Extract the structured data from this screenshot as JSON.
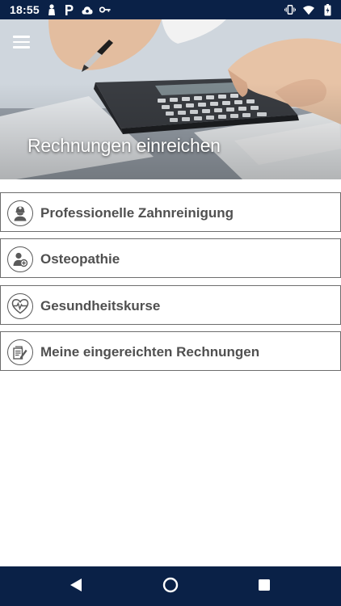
{
  "status_bar": {
    "time": "18:55",
    "left_icons": [
      "person-icon",
      "parking-icon",
      "cloud-icon",
      "key-icon"
    ],
    "right_icons": [
      "vibrate-icon",
      "wifi-icon",
      "battery-icon"
    ]
  },
  "header": {
    "title": "Rechnungen einreichen",
    "menu_icon": "hamburger-icon"
  },
  "menu_items": [
    {
      "label": "Professionelle Zahnreinigung",
      "icon": "dentist-icon"
    },
    {
      "label": "Osteopathie",
      "icon": "person-plus-icon"
    },
    {
      "label": "Gesundheitskurse",
      "icon": "heart-pulse-icon"
    },
    {
      "label": "Meine eingereichten Rechnungen",
      "icon": "document-edit-icon"
    }
  ],
  "nav_bar": {
    "back_icon": "back-triangle-icon",
    "home_icon": "home-circle-icon",
    "recents_icon": "recents-square-icon"
  },
  "colors": {
    "bar_background": "#0a2147",
    "item_border": "#6d6d6d",
    "item_text": "#505050"
  }
}
